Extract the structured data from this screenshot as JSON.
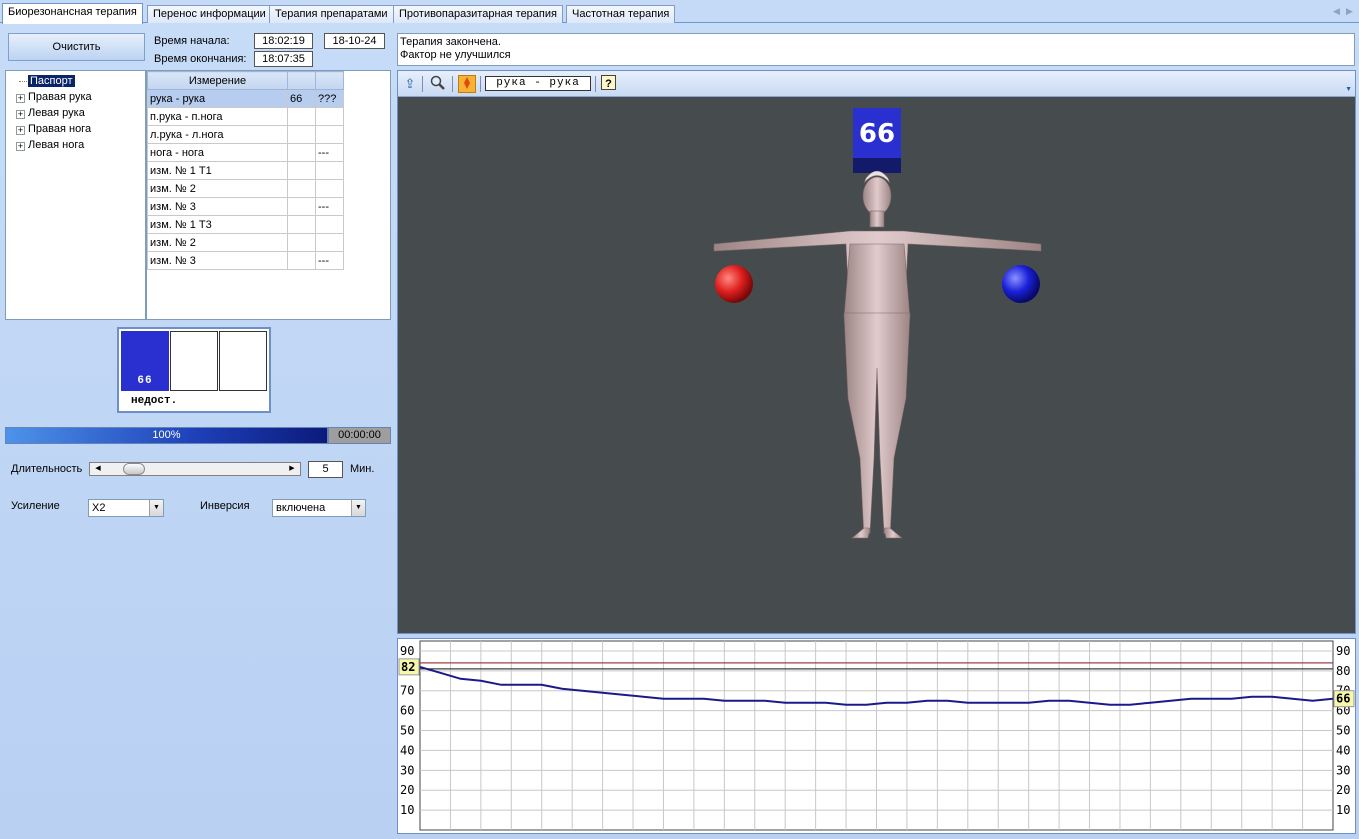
{
  "tabs": [
    {
      "label": "Биорезонансная терапия",
      "active": true
    },
    {
      "label": "Перенос информации",
      "active": false
    },
    {
      "label": "Терапия препаратами",
      "active": false
    },
    {
      "label": "Противопаразитарная терапия",
      "active": false
    },
    {
      "label": "Частотная терапия",
      "active": false
    }
  ],
  "left": {
    "clear_button": "Очистить",
    "start_label": "Время начала:",
    "end_label": "Время окончания:",
    "start_time": "18:02:19",
    "end_time": "18:07:35",
    "date": "18-10-24"
  },
  "tree": [
    {
      "label": "Паспорт",
      "selected": true
    },
    {
      "label": "Правая рука"
    },
    {
      "label": "Левая рука"
    },
    {
      "label": "Правая нога"
    },
    {
      "label": "Левая нога"
    }
  ],
  "grid": {
    "header": "Измерение",
    "rows": [
      {
        "name": "рука - рука",
        "v1": "66",
        "v2": "???",
        "selected": true
      },
      {
        "name": "п.рука - п.нога",
        "v1": "",
        "v2": ""
      },
      {
        "name": "л.рука - л.нога",
        "v1": "",
        "v2": ""
      },
      {
        "name": "нога - нога",
        "v1": "",
        "v2": "---"
      },
      {
        "name": "изм. № 1  T1",
        "v1": "",
        "v2": ""
      },
      {
        "name": "изм. № 2",
        "v1": "",
        "v2": ""
      },
      {
        "name": "изм. № 3",
        "v1": "",
        "v2": "---"
      },
      {
        "name": "изм. № 1  T3",
        "v1": "",
        "v2": ""
      },
      {
        "name": "изм. № 2",
        "v1": "",
        "v2": ""
      },
      {
        "name": "изм. № 3",
        "v1": "",
        "v2": "---"
      }
    ]
  },
  "meter": {
    "value": "66",
    "label": "недост."
  },
  "progress": {
    "percent_label": "100%",
    "time": "00:00:00",
    "fill": 1.0
  },
  "duration": {
    "label": "Длительность",
    "value": "5",
    "unit": "Мин.",
    "level": 0.2
  },
  "gain": {
    "label": "Усиление",
    "value": "X2"
  },
  "inversion": {
    "label": "Инверсия",
    "value": "включена"
  },
  "status": {
    "line1": "Терапия закончена.",
    "line2": "Фактор не улучшился"
  },
  "viewer": {
    "mode_field": "рука - рука",
    "value_badge": "66",
    "icons": [
      "export-icon",
      "zoom-icon",
      "highlight-icon",
      "help-icon"
    ],
    "colors": {
      "background": "#464b4e",
      "badge": "#2a2fd0",
      "left_sphere": "#e02020",
      "right_sphere": "#1a20d8"
    }
  },
  "chart_data": {
    "type": "line",
    "y_ticks": [
      "90",
      "80",
      "70",
      "60",
      "50",
      "40",
      "30",
      "20",
      "10"
    ],
    "ylim": [
      0,
      95
    ],
    "reference_lines": [
      {
        "y": 84,
        "color": "#a04040"
      },
      {
        "y": 81,
        "color": "#404040"
      }
    ],
    "series": [
      {
        "color": "#1a1a8c",
        "values": [
          82,
          79,
          76,
          75,
          73,
          73,
          73,
          71,
          70,
          69,
          68,
          67,
          66,
          66,
          66,
          65,
          65,
          65,
          64,
          64,
          64,
          63,
          63,
          64,
          64,
          65,
          65,
          64,
          64,
          64,
          64,
          65,
          65,
          64,
          63,
          63,
          64,
          65,
          66,
          66,
          66,
          67,
          67,
          66,
          65,
          66
        ]
      }
    ],
    "start_marker": "82",
    "end_marker": "66"
  }
}
